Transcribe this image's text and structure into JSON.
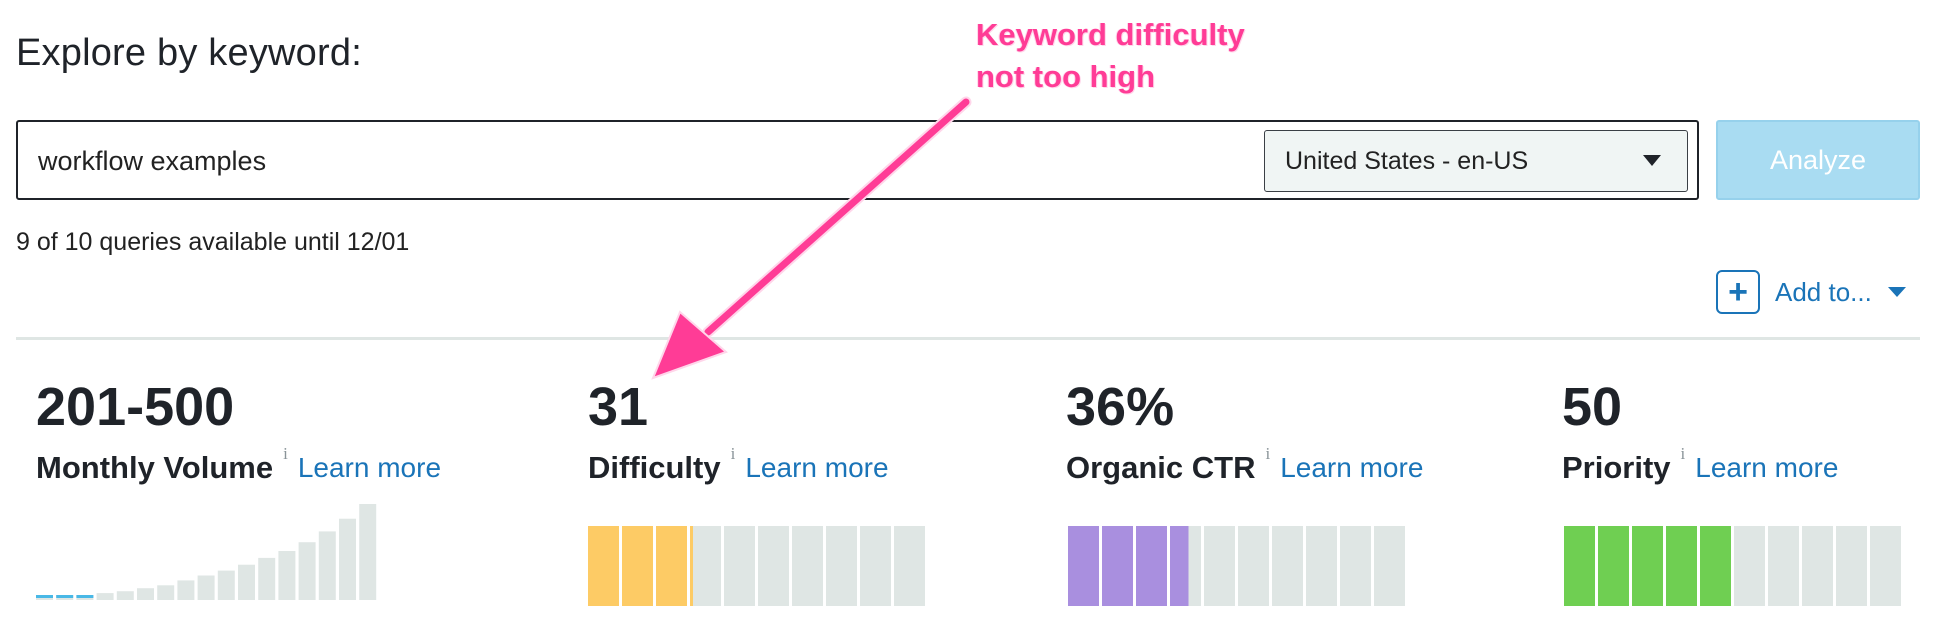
{
  "page": {
    "title": "Explore by keyword:"
  },
  "search": {
    "value": "workflow examples",
    "locale": "United States - en-US",
    "analyze_label": "Analyze"
  },
  "queries_text": "9 of 10 queries available until 12/01",
  "add_to_label": "Add to...",
  "metrics": [
    {
      "value": "201-500",
      "label": "Monthly Volume",
      "info": "i",
      "link": "Learn more",
      "chart": {
        "type": "bar",
        "values": [
          0.5,
          0.5,
          0.5,
          0.7,
          0.9,
          1.2,
          1.5,
          2,
          2.5,
          3,
          3.6,
          4.3,
          5,
          5.9,
          7,
          8.3,
          9.8
        ]
      }
    },
    {
      "value": "31",
      "label": "Difficulty",
      "info": "i",
      "link": "Learn more",
      "meter": {
        "fill": 0.31,
        "segments": 10,
        "color": "#fdcb65"
      }
    },
    {
      "value": "36%",
      "label": "Organic CTR",
      "info": "i",
      "link": "Learn more",
      "meter": {
        "fill": 0.36,
        "segments": 10,
        "color": "#a98fdf"
      }
    },
    {
      "value": "50",
      "label": "Priority",
      "info": "i",
      "link": "Learn more",
      "meter": {
        "fill": 0.5,
        "segments": 10,
        "color": "#6fcf52"
      }
    }
  ],
  "annotation": {
    "line1": "Keyword difficulty",
    "line2": "not too high"
  },
  "colors": {
    "link": "#1a74b8",
    "analyze_bg": "#a9dcf2",
    "annotation": "#ff3c96",
    "meter_empty": "#dfe6e4",
    "volume_highlight": "#49b8e6"
  },
  "icons": [
    "plus-icon",
    "chevron-down-icon",
    "info-icon"
  ]
}
